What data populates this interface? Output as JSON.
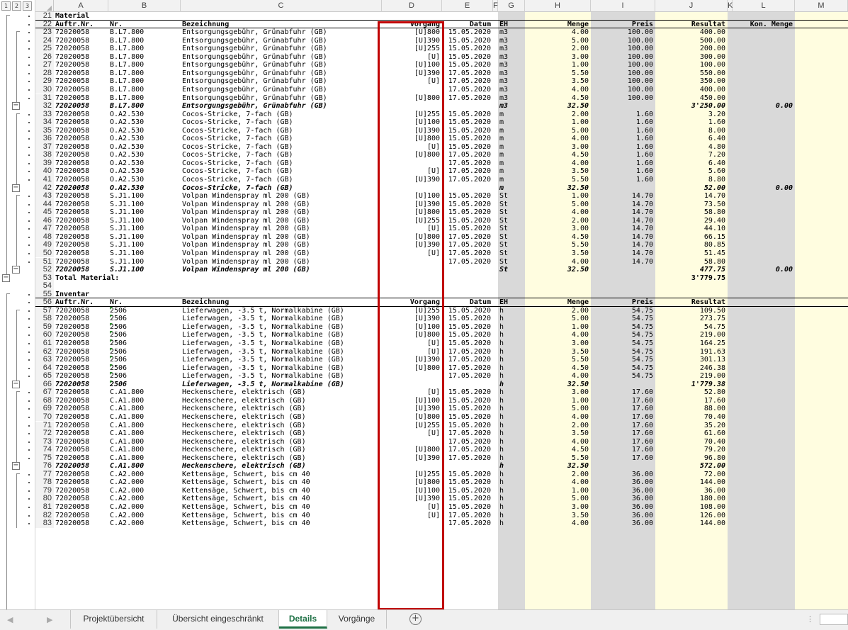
{
  "outline": {
    "levels": [
      "1",
      "2",
      "3"
    ]
  },
  "columns": [
    {
      "id": "A",
      "left": 0
    },
    {
      "id": "B",
      "left": 0
    },
    {
      "id": "C",
      "left": 0
    },
    {
      "id": "D",
      "left": 0
    },
    {
      "id": "E",
      "left": 0
    },
    {
      "id": "F",
      "left": 0
    },
    {
      "id": "G",
      "left": 0
    },
    {
      "id": "H",
      "left": 0
    },
    {
      "id": "I",
      "left": 0
    },
    {
      "id": "J",
      "left": 0
    },
    {
      "id": "K",
      "left": 0
    },
    {
      "id": "L",
      "left": 0
    },
    {
      "id": "M",
      "left": 0
    }
  ],
  "rows": [
    {
      "n": "21",
      "type": "sec",
      "cells": {
        "A": "Material"
      }
    },
    {
      "n": "22",
      "type": "hdr",
      "cells": {
        "A": "Auftr.Nr.",
        "B": "Nr.",
        "C": "Bezeichnung",
        "D": "Vorgang",
        "E": "Datum",
        "G": "EH",
        "H": "Menge",
        "I": "Preis",
        "J": "Resultat",
        "L": "Kon. Menge"
      }
    },
    {
      "n": "23",
      "cells": {
        "A": "72020058",
        "B": "B.L7.800",
        "C": "Entsorgungsgebühr, Grünabfuhr (GB)",
        "D": "[U]800",
        "E": "15.05.2020",
        "G": "m3",
        "H": "4.00",
        "I": "100.00",
        "J": "400.00"
      }
    },
    {
      "n": "24",
      "cells": {
        "A": "72020058",
        "B": "B.L7.800",
        "C": "Entsorgungsgebühr, Grünabfuhr (GB)",
        "D": "[U]390",
        "E": "15.05.2020",
        "G": "m3",
        "H": "5.00",
        "I": "100.00",
        "J": "500.00"
      }
    },
    {
      "n": "25",
      "cells": {
        "A": "72020058",
        "B": "B.L7.800",
        "C": "Entsorgungsgebühr, Grünabfuhr (GB)",
        "D": "[U]255",
        "E": "15.05.2020",
        "G": "m3",
        "H": "2.00",
        "I": "100.00",
        "J": "200.00"
      }
    },
    {
      "n": "26",
      "cells": {
        "A": "72020058",
        "B": "B.L7.800",
        "C": "Entsorgungsgebühr, Grünabfuhr (GB)",
        "D": "[U]",
        "E": "15.05.2020",
        "G": "m3",
        "H": "3.00",
        "I": "100.00",
        "J": "300.00"
      }
    },
    {
      "n": "27",
      "cells": {
        "A": "72020058",
        "B": "B.L7.800",
        "C": "Entsorgungsgebühr, Grünabfuhr (GB)",
        "D": "[U]100",
        "E": "15.05.2020",
        "G": "m3",
        "H": "1.00",
        "I": "100.00",
        "J": "100.00"
      }
    },
    {
      "n": "28",
      "cells": {
        "A": "72020058",
        "B": "B.L7.800",
        "C": "Entsorgungsgebühr, Grünabfuhr (GB)",
        "D": "[U]390",
        "E": "17.05.2020",
        "G": "m3",
        "H": "5.50",
        "I": "100.00",
        "J": "550.00"
      }
    },
    {
      "n": "29",
      "cells": {
        "A": "72020058",
        "B": "B.L7.800",
        "C": "Entsorgungsgebühr, Grünabfuhr (GB)",
        "D": "[U]",
        "E": "17.05.2020",
        "G": "m3",
        "H": "3.50",
        "I": "100.00",
        "J": "350.00"
      }
    },
    {
      "n": "30",
      "cells": {
        "A": "72020058",
        "B": "B.L7.800",
        "C": "Entsorgungsgebühr, Grünabfuhr (GB)",
        "D": "",
        "E": "17.05.2020",
        "G": "m3",
        "H": "4.00",
        "I": "100.00",
        "J": "400.00"
      }
    },
    {
      "n": "31",
      "cells": {
        "A": "72020058",
        "B": "B.L7.800",
        "C": "Entsorgungsgebühr, Grünabfuhr (GB)",
        "D": "[U]800",
        "E": "17.05.2020",
        "G": "m3",
        "H": "4.50",
        "I": "100.00",
        "J": "450.00"
      }
    },
    {
      "n": "32",
      "type": "sum",
      "cells": {
        "A": "72020058",
        "B": "B.L7.800",
        "C": "Entsorgungsgebühr, Grünabfuhr (GB)",
        "G": "m3",
        "H": "32.50",
        "J": "3'250.00",
        "L": "0.00"
      }
    },
    {
      "n": "33",
      "cells": {
        "A": "72020058",
        "B": "O.A2.530",
        "C": "Cocos-Stricke, 7-fach (GB)",
        "D": "[U]255",
        "E": "15.05.2020",
        "G": "m",
        "H": "2.00",
        "I": "1.60",
        "J": "3.20"
      }
    },
    {
      "n": "34",
      "cells": {
        "A": "72020058",
        "B": "O.A2.530",
        "C": "Cocos-Stricke, 7-fach (GB)",
        "D": "[U]100",
        "E": "15.05.2020",
        "G": "m",
        "H": "1.00",
        "I": "1.60",
        "J": "1.60"
      }
    },
    {
      "n": "35",
      "cells": {
        "A": "72020058",
        "B": "O.A2.530",
        "C": "Cocos-Stricke, 7-fach (GB)",
        "D": "[U]390",
        "E": "15.05.2020",
        "G": "m",
        "H": "5.00",
        "I": "1.60",
        "J": "8.00"
      }
    },
    {
      "n": "36",
      "cells": {
        "A": "72020058",
        "B": "O.A2.530",
        "C": "Cocos-Stricke, 7-fach (GB)",
        "D": "[U]800",
        "E": "15.05.2020",
        "G": "m",
        "H": "4.00",
        "I": "1.60",
        "J": "6.40"
      }
    },
    {
      "n": "37",
      "cells": {
        "A": "72020058",
        "B": "O.A2.530",
        "C": "Cocos-Stricke, 7-fach (GB)",
        "D": "[U]",
        "E": "15.05.2020",
        "G": "m",
        "H": "3.00",
        "I": "1.60",
        "J": "4.80"
      }
    },
    {
      "n": "38",
      "cells": {
        "A": "72020058",
        "B": "O.A2.530",
        "C": "Cocos-Stricke, 7-fach (GB)",
        "D": "[U]800",
        "E": "17.05.2020",
        "G": "m",
        "H": "4.50",
        "I": "1.60",
        "J": "7.20"
      }
    },
    {
      "n": "39",
      "cells": {
        "A": "72020058",
        "B": "O.A2.530",
        "C": "Cocos-Stricke, 7-fach (GB)",
        "D": "",
        "E": "17.05.2020",
        "G": "m",
        "H": "4.00",
        "I": "1.60",
        "J": "6.40"
      }
    },
    {
      "n": "40",
      "cells": {
        "A": "72020058",
        "B": "O.A2.530",
        "C": "Cocos-Stricke, 7-fach (GB)",
        "D": "[U]",
        "E": "17.05.2020",
        "G": "m",
        "H": "3.50",
        "I": "1.60",
        "J": "5.60"
      }
    },
    {
      "n": "41",
      "cells": {
        "A": "72020058",
        "B": "O.A2.530",
        "C": "Cocos-Stricke, 7-fach (GB)",
        "D": "[U]390",
        "E": "17.05.2020",
        "G": "m",
        "H": "5.50",
        "I": "1.60",
        "J": "8.80"
      }
    },
    {
      "n": "42",
      "type": "sum",
      "cells": {
        "A": "72020058",
        "B": "O.A2.530",
        "C": "Cocos-Stricke, 7-fach (GB)",
        "G": "m",
        "H": "32.50",
        "J": "52.00",
        "L": "0.00"
      }
    },
    {
      "n": "43",
      "cells": {
        "A": "72020058",
        "B": "S.J1.100",
        "C": "Volpan Windenspray ml 200 (GB)",
        "D": "[U]100",
        "E": "15.05.2020",
        "G": "St",
        "H": "1.00",
        "I": "14.70",
        "J": "14.70"
      }
    },
    {
      "n": "44",
      "cells": {
        "A": "72020058",
        "B": "S.J1.100",
        "C": "Volpan Windenspray ml 200 (GB)",
        "D": "[U]390",
        "E": "15.05.2020",
        "G": "St",
        "H": "5.00",
        "I": "14.70",
        "J": "73.50"
      }
    },
    {
      "n": "45",
      "cells": {
        "A": "72020058",
        "B": "S.J1.100",
        "C": "Volpan Windenspray ml 200 (GB)",
        "D": "[U]800",
        "E": "15.05.2020",
        "G": "St",
        "H": "4.00",
        "I": "14.70",
        "J": "58.80"
      }
    },
    {
      "n": "46",
      "cells": {
        "A": "72020058",
        "B": "S.J1.100",
        "C": "Volpan Windenspray ml 200 (GB)",
        "D": "[U]255",
        "E": "15.05.2020",
        "G": "St",
        "H": "2.00",
        "I": "14.70",
        "J": "29.40"
      }
    },
    {
      "n": "47",
      "cells": {
        "A": "72020058",
        "B": "S.J1.100",
        "C": "Volpan Windenspray ml 200 (GB)",
        "D": "[U]",
        "E": "15.05.2020",
        "G": "St",
        "H": "3.00",
        "I": "14.70",
        "J": "44.10"
      }
    },
    {
      "n": "48",
      "cells": {
        "A": "72020058",
        "B": "S.J1.100",
        "C": "Volpan Windenspray ml 200 (GB)",
        "D": "[U]800",
        "E": "17.05.2020",
        "G": "St",
        "H": "4.50",
        "I": "14.70",
        "J": "66.15"
      }
    },
    {
      "n": "49",
      "cells": {
        "A": "72020058",
        "B": "S.J1.100",
        "C": "Volpan Windenspray ml 200 (GB)",
        "D": "[U]390",
        "E": "17.05.2020",
        "G": "St",
        "H": "5.50",
        "I": "14.70",
        "J": "80.85"
      }
    },
    {
      "n": "50",
      "cells": {
        "A": "72020058",
        "B": "S.J1.100",
        "C": "Volpan Windenspray ml 200 (GB)",
        "D": "[U]",
        "E": "17.05.2020",
        "G": "St",
        "H": "3.50",
        "I": "14.70",
        "J": "51.45"
      }
    },
    {
      "n": "51",
      "cells": {
        "A": "72020058",
        "B": "S.J1.100",
        "C": "Volpan Windenspray ml 200 (GB)",
        "D": "",
        "E": "17.05.2020",
        "G": "St",
        "H": "4.00",
        "I": "14.70",
        "J": "58.80"
      }
    },
    {
      "n": "52",
      "type": "sum",
      "cells": {
        "A": "72020058",
        "B": "S.J1.100",
        "C": "Volpan Windenspray ml 200 (GB)",
        "G": "St",
        "H": "32.50",
        "J": "477.75",
        "L": "0.00"
      }
    },
    {
      "n": "53",
      "type": "sec",
      "cells": {
        "A": "Total Material:",
        "J": "3'779.75"
      }
    },
    {
      "n": "54",
      "cells": {}
    },
    {
      "n": "55",
      "type": "sec",
      "cells": {
        "A": "Inventar"
      }
    },
    {
      "n": "56",
      "type": "hdr",
      "cells": {
        "A": "Auftr.Nr.",
        "B": "Nr.",
        "C": "Bezeichnung",
        "D": "Vorgang",
        "E": "Datum",
        "G": "EH",
        "H": "Menge",
        "I": "Preis",
        "J": "Resultat"
      }
    },
    {
      "n": "57",
      "flag": true,
      "cells": {
        "A": "72020058",
        "B": "2506",
        "C": "Lieferwagen, -3.5 t, Normalkabine (GB)",
        "D": "[U]255",
        "E": "15.05.2020",
        "G": "h",
        "H": "2.00",
        "I": "54.75",
        "J": "109.50"
      }
    },
    {
      "n": "58",
      "flag": true,
      "cells": {
        "A": "72020058",
        "B": "2506",
        "C": "Lieferwagen, -3.5 t, Normalkabine (GB)",
        "D": "[U]390",
        "E": "15.05.2020",
        "G": "h",
        "H": "5.00",
        "I": "54.75",
        "J": "273.75"
      }
    },
    {
      "n": "59",
      "flag": true,
      "cells": {
        "A": "72020058",
        "B": "2506",
        "C": "Lieferwagen, -3.5 t, Normalkabine (GB)",
        "D": "[U]100",
        "E": "15.05.2020",
        "G": "h",
        "H": "1.00",
        "I": "54.75",
        "J": "54.75"
      }
    },
    {
      "n": "60",
      "flag": true,
      "cells": {
        "A": "72020058",
        "B": "2506",
        "C": "Lieferwagen, -3.5 t, Normalkabine (GB)",
        "D": "[U]800",
        "E": "15.05.2020",
        "G": "h",
        "H": "4.00",
        "I": "54.75",
        "J": "219.00"
      }
    },
    {
      "n": "61",
      "flag": true,
      "cells": {
        "A": "72020058",
        "B": "2506",
        "C": "Lieferwagen, -3.5 t, Normalkabine (GB)",
        "D": "[U]",
        "E": "15.05.2020",
        "G": "h",
        "H": "3.00",
        "I": "54.75",
        "J": "164.25"
      }
    },
    {
      "n": "62",
      "flag": true,
      "cells": {
        "A": "72020058",
        "B": "2506",
        "C": "Lieferwagen, -3.5 t, Normalkabine (GB)",
        "D": "[U]",
        "E": "17.05.2020",
        "G": "h",
        "H": "3.50",
        "I": "54.75",
        "J": "191.63"
      }
    },
    {
      "n": "63",
      "flag": true,
      "cells": {
        "A": "72020058",
        "B": "2506",
        "C": "Lieferwagen, -3.5 t, Normalkabine (GB)",
        "D": "[U]390",
        "E": "17.05.2020",
        "G": "h",
        "H": "5.50",
        "I": "54.75",
        "J": "301.13"
      }
    },
    {
      "n": "64",
      "flag": true,
      "cells": {
        "A": "72020058",
        "B": "2506",
        "C": "Lieferwagen, -3.5 t, Normalkabine (GB)",
        "D": "[U]800",
        "E": "17.05.2020",
        "G": "h",
        "H": "4.50",
        "I": "54.75",
        "J": "246.38"
      }
    },
    {
      "n": "65",
      "flag": true,
      "cells": {
        "A": "72020058",
        "B": "2506",
        "C": "Lieferwagen, -3.5 t, Normalkabine (GB)",
        "D": "",
        "E": "17.05.2020",
        "G": "h",
        "H": "4.00",
        "I": "54.75",
        "J": "219.00"
      }
    },
    {
      "n": "66",
      "type": "sum",
      "flag": true,
      "cells": {
        "A": "72020058",
        "B": "2506",
        "C": "Lieferwagen, -3.5 t, Normalkabine (GB)",
        "G": "h",
        "H": "32.50",
        "J": "1'779.38"
      }
    },
    {
      "n": "67",
      "cells": {
        "A": "72020058",
        "B": "C.A1.800",
        "C": "Heckenschere, elektrisch (GB)",
        "D": "[U]",
        "E": "15.05.2020",
        "G": "h",
        "H": "3.00",
        "I": "17.60",
        "J": "52.80"
      }
    },
    {
      "n": "68",
      "cells": {
        "A": "72020058",
        "B": "C.A1.800",
        "C": "Heckenschere, elektrisch (GB)",
        "D": "[U]100",
        "E": "15.05.2020",
        "G": "h",
        "H": "1.00",
        "I": "17.60",
        "J": "17.60"
      }
    },
    {
      "n": "69",
      "cells": {
        "A": "72020058",
        "B": "C.A1.800",
        "C": "Heckenschere, elektrisch (GB)",
        "D": "[U]390",
        "E": "15.05.2020",
        "G": "h",
        "H": "5.00",
        "I": "17.60",
        "J": "88.00"
      }
    },
    {
      "n": "70",
      "cells": {
        "A": "72020058",
        "B": "C.A1.800",
        "C": "Heckenschere, elektrisch (GB)",
        "D": "[U]800",
        "E": "15.05.2020",
        "G": "h",
        "H": "4.00",
        "I": "17.60",
        "J": "70.40"
      }
    },
    {
      "n": "71",
      "cells": {
        "A": "72020058",
        "B": "C.A1.800",
        "C": "Heckenschere, elektrisch (GB)",
        "D": "[U]255",
        "E": "15.05.2020",
        "G": "h",
        "H": "2.00",
        "I": "17.60",
        "J": "35.20"
      }
    },
    {
      "n": "72",
      "cells": {
        "A": "72020058",
        "B": "C.A1.800",
        "C": "Heckenschere, elektrisch (GB)",
        "D": "[U]",
        "E": "17.05.2020",
        "G": "h",
        "H": "3.50",
        "I": "17.60",
        "J": "61.60"
      }
    },
    {
      "n": "73",
      "cells": {
        "A": "72020058",
        "B": "C.A1.800",
        "C": "Heckenschere, elektrisch (GB)",
        "D": "",
        "E": "17.05.2020",
        "G": "h",
        "H": "4.00",
        "I": "17.60",
        "J": "70.40"
      }
    },
    {
      "n": "74",
      "cells": {
        "A": "72020058",
        "B": "C.A1.800",
        "C": "Heckenschere, elektrisch (GB)",
        "D": "[U]800",
        "E": "17.05.2020",
        "G": "h",
        "H": "4.50",
        "I": "17.60",
        "J": "79.20"
      }
    },
    {
      "n": "75",
      "cells": {
        "A": "72020058",
        "B": "C.A1.800",
        "C": "Heckenschere, elektrisch (GB)",
        "D": "[U]390",
        "E": "17.05.2020",
        "G": "h",
        "H": "5.50",
        "I": "17.60",
        "J": "96.80"
      }
    },
    {
      "n": "76",
      "type": "sum",
      "cells": {
        "A": "72020058",
        "B": "C.A1.800",
        "C": "Heckenschere, elektrisch (GB)",
        "G": "h",
        "H": "32.50",
        "J": "572.00"
      }
    },
    {
      "n": "77",
      "cells": {
        "A": "72020058",
        "B": "C.A2.000",
        "C": "Kettensäge, Schwert, bis cm 40",
        "D": "[U]255",
        "E": "15.05.2020",
        "G": "h",
        "H": "2.00",
        "I": "36.00",
        "J": "72.00"
      }
    },
    {
      "n": "78",
      "cells": {
        "A": "72020058",
        "B": "C.A2.000",
        "C": "Kettensäge, Schwert, bis cm 40",
        "D": "[U]800",
        "E": "15.05.2020",
        "G": "h",
        "H": "4.00",
        "I": "36.00",
        "J": "144.00"
      }
    },
    {
      "n": "79",
      "cells": {
        "A": "72020058",
        "B": "C.A2.000",
        "C": "Kettensäge, Schwert, bis cm 40",
        "D": "[U]100",
        "E": "15.05.2020",
        "G": "h",
        "H": "1.00",
        "I": "36.00",
        "J": "36.00"
      }
    },
    {
      "n": "80",
      "cells": {
        "A": "72020058",
        "B": "C.A2.000",
        "C": "Kettensäge, Schwert, bis cm 40",
        "D": "[U]390",
        "E": "15.05.2020",
        "G": "h",
        "H": "5.00",
        "I": "36.00",
        "J": "180.00"
      }
    },
    {
      "n": "81",
      "cells": {
        "A": "72020058",
        "B": "C.A2.000",
        "C": "Kettensäge, Schwert, bis cm 40",
        "D": "[U]",
        "E": "15.05.2020",
        "G": "h",
        "H": "3.00",
        "I": "36.00",
        "J": "108.00"
      }
    },
    {
      "n": "82",
      "cells": {
        "A": "72020058",
        "B": "C.A2.000",
        "C": "Kettensäge, Schwert, bis cm 40",
        "D": "[U]",
        "E": "17.05.2020",
        "G": "h",
        "H": "3.50",
        "I": "36.00",
        "J": "126.00"
      }
    },
    {
      "n": "83",
      "cells": {
        "A": "72020058",
        "B": "C.A2.000",
        "C": "Kettensäge, Schwert, bis cm 40",
        "D": "",
        "E": "17.05.2020",
        "G": "h",
        "H": "4.00",
        "I": "36.00",
        "J": "144.00"
      }
    }
  ],
  "tabs": [
    {
      "label": "Projektübersicht",
      "active": false
    },
    {
      "label": "Übersicht eingeschränkt",
      "active": false
    },
    {
      "label": "Details",
      "active": true
    },
    {
      "label": "Vorgänge",
      "active": false
    }
  ],
  "add_sheet_label": "+",
  "menu_dots": "⋮",
  "colors": {
    "gray_column": "#d9d9d9",
    "yellow_column": "#fffde0",
    "highlight_border": "#c00000",
    "active_tab": "#1e7145"
  }
}
